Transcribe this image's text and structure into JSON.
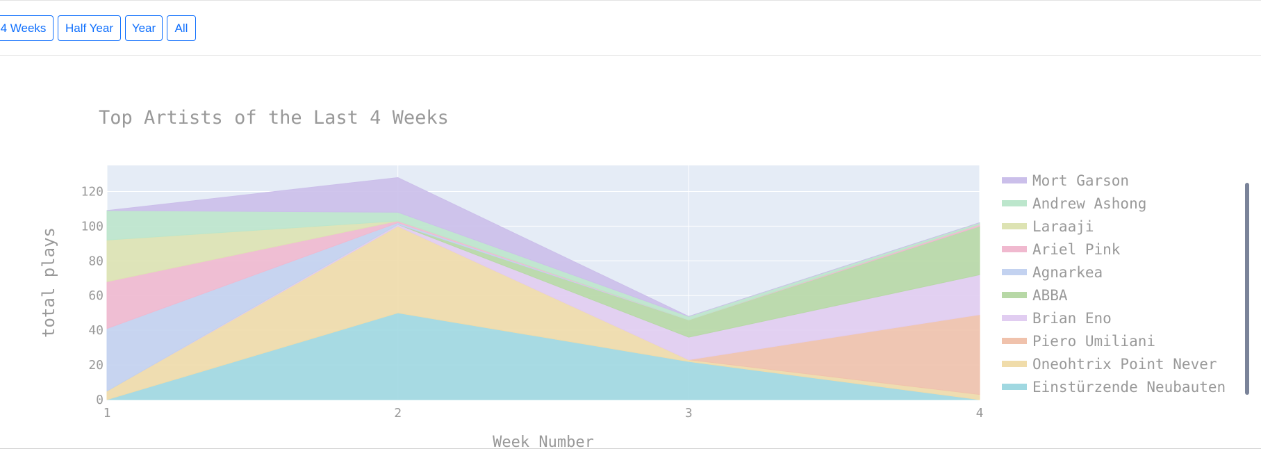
{
  "range_buttons": [
    "4 Weeks",
    "Half Year",
    "Year",
    "All"
  ],
  "colors": {
    "plot_bg": "#e5ecf6",
    "grid": "#ffffff",
    "text": "#999999",
    "button": "#0d6efd",
    "scrollbar": "#7a8399"
  },
  "chart_data": {
    "type": "area",
    "stacked": true,
    "title": "Top Artists of the Last 4 Weeks",
    "xlabel": "Week Number",
    "ylabel": "total plays",
    "x": [
      1,
      2,
      3,
      4
    ],
    "xlim": [
      1,
      4
    ],
    "ylim": [
      0,
      135
    ],
    "yticks": [
      0,
      20,
      40,
      60,
      80,
      100,
      120
    ],
    "grid": true,
    "legend_position": "right",
    "series": [
      {
        "name": "Einstürzende Neubauten",
        "values": [
          0,
          50,
          22,
          0
        ],
        "color": "#a0d8e1"
      },
      {
        "name": "Oneohtrix Point Never",
        "values": [
          5,
          50,
          1,
          3
        ],
        "color": "#f0dcaa"
      },
      {
        "name": "Piero Umiliani",
        "values": [
          0,
          0,
          0,
          46
        ],
        "color": "#f0c2ac"
      },
      {
        "name": "Brian Eno",
        "values": [
          0,
          1,
          13,
          23
        ],
        "color": "#e1cdf1"
      },
      {
        "name": "ABBA",
        "values": [
          0,
          0,
          10,
          28
        ],
        "color": "#b7d8a6"
      },
      {
        "name": "Agnarkea",
        "values": [
          36,
          1,
          0,
          0
        ],
        "color": "#c3d2f0"
      },
      {
        "name": "Ariel Pink",
        "values": [
          27,
          1,
          0,
          1
        ],
        "color": "#f0b9cf"
      },
      {
        "name": "Laraaji",
        "values": [
          24,
          0,
          0,
          0
        ],
        "color": "#dde3b3"
      },
      {
        "name": "Andrew Ashong",
        "values": [
          17,
          5,
          2,
          1
        ],
        "color": "#bce6cc"
      },
      {
        "name": "Mort Garson",
        "values": [
          0,
          20,
          0,
          0
        ],
        "color": "#cbbfea"
      }
    ]
  }
}
